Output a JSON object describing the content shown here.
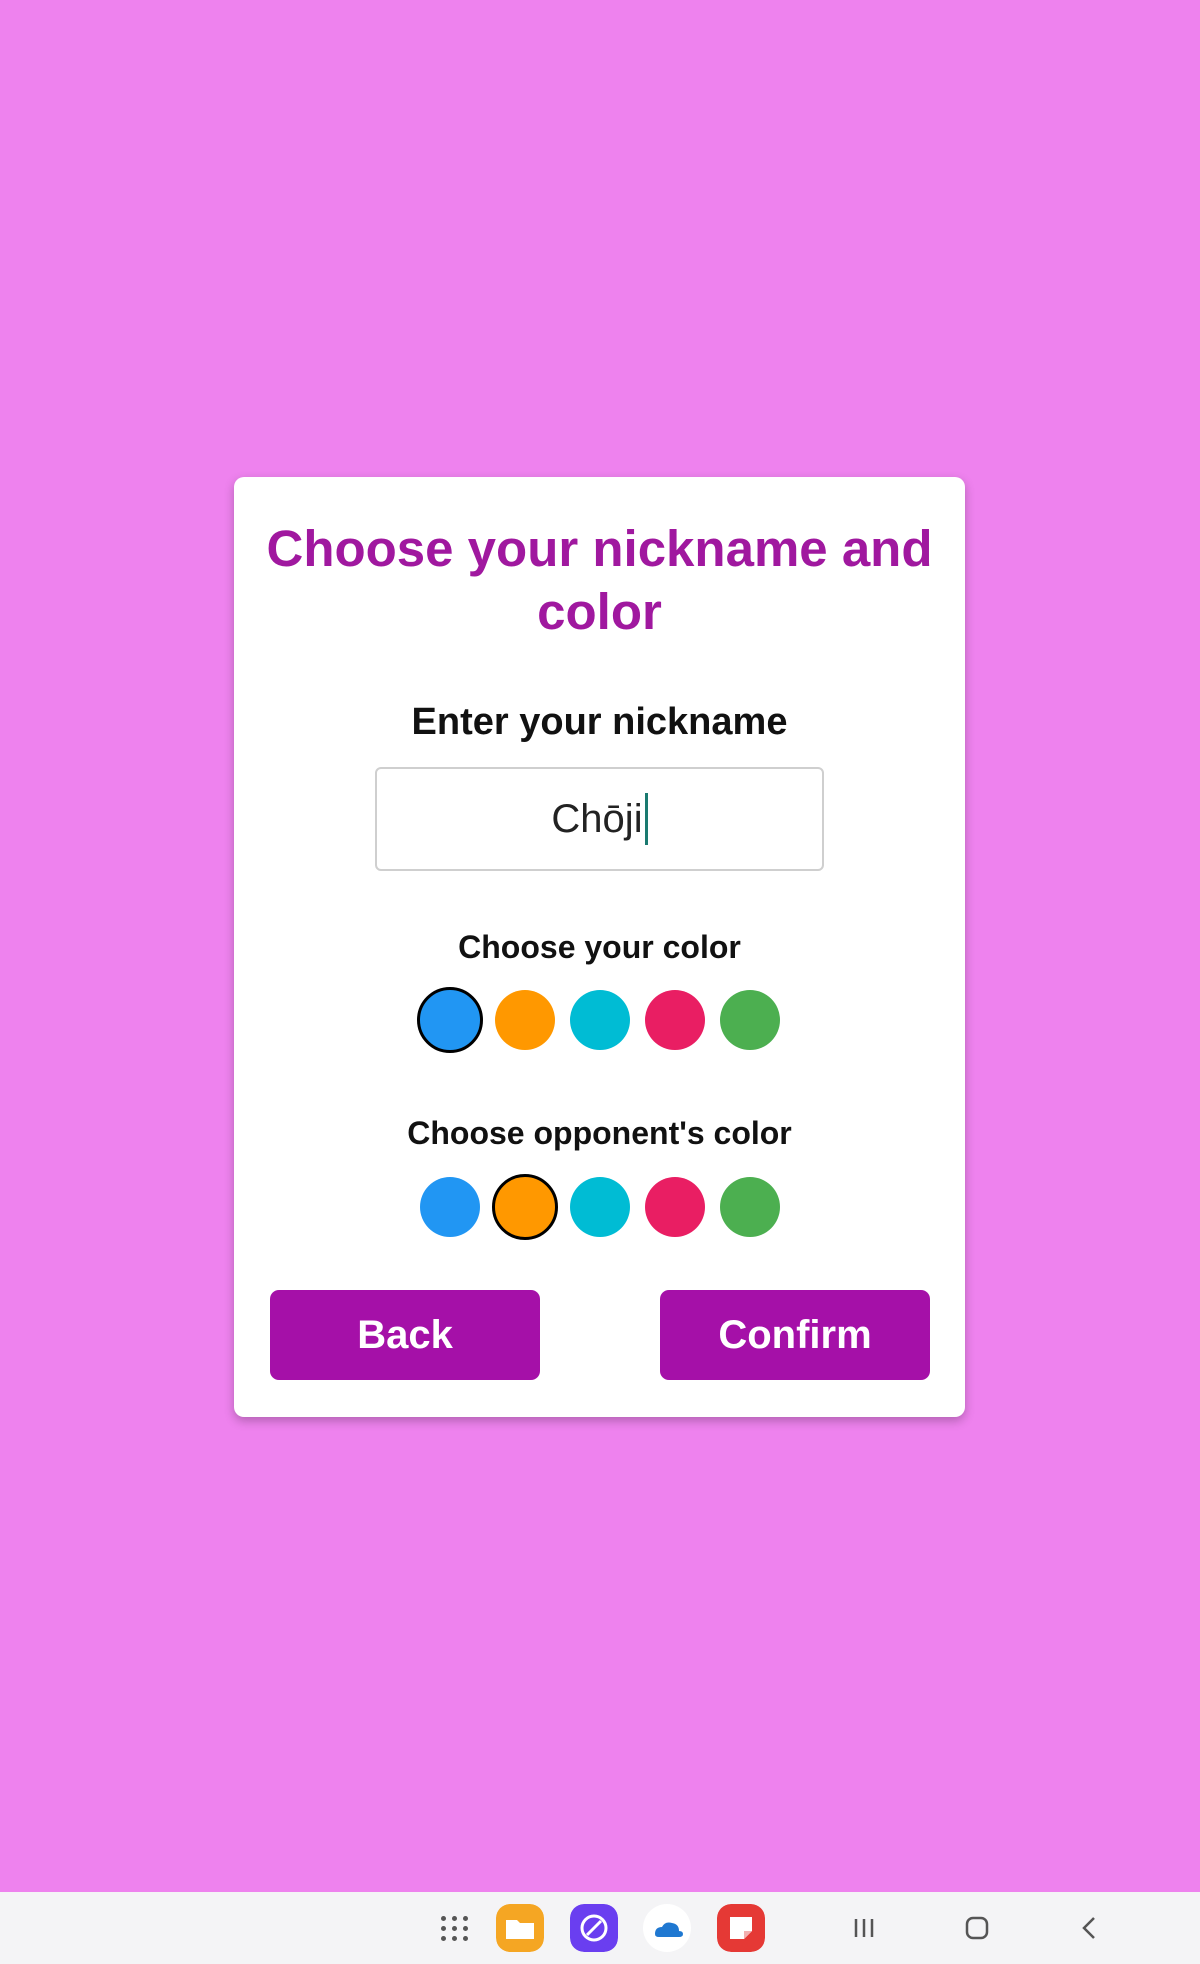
{
  "dialog": {
    "title": "Choose your nickname and color",
    "nickname_label": "Enter your nickname",
    "nickname_value": "Chōji",
    "own_color_label": "Choose your color",
    "opponent_color_label": "Choose opponent's color",
    "back_label": "Back",
    "confirm_label": "Confirm"
  },
  "colors": {
    "options": [
      "#2196f3",
      "#ff9800",
      "#00bcd4",
      "#e91e63",
      "#4caf50"
    ],
    "own_selected": "#2196f3",
    "opponent_selected": "#ff9800",
    "accent": "#a510a8",
    "background": "#ee82ee"
  },
  "taskbar": {
    "icons": [
      "app-drawer-icon",
      "my-files-icon",
      "internet-browser-icon",
      "onedrive-icon",
      "notes-icon",
      "recent-apps-icon",
      "home-icon",
      "back-icon"
    ]
  }
}
